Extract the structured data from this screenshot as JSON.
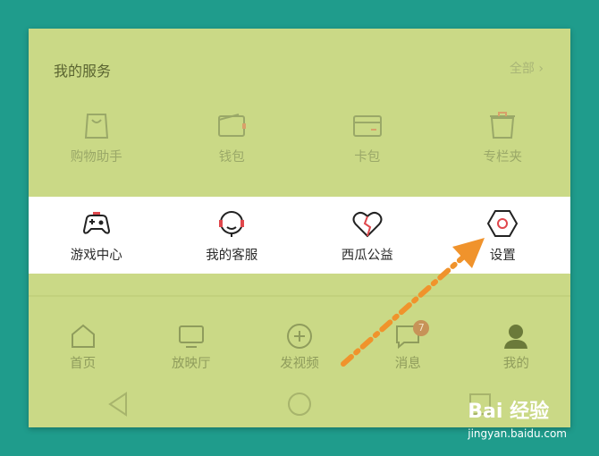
{
  "section": {
    "title": "我的服务",
    "see_all": "全部 ›"
  },
  "services_row1": [
    {
      "label": "购物助手",
      "icon": "shopping-bag-icon"
    },
    {
      "label": "钱包",
      "icon": "wallet-icon"
    },
    {
      "label": "卡包",
      "icon": "card-icon"
    },
    {
      "label": "专栏夹",
      "icon": "column-folder-icon"
    }
  ],
  "services_row2": [
    {
      "label": "游戏中心",
      "icon": "gamepad-icon"
    },
    {
      "label": "我的客服",
      "icon": "headset-icon"
    },
    {
      "label": "西瓜公益",
      "icon": "heart-icon"
    },
    {
      "label": "设置",
      "icon": "hex-settings-icon"
    }
  ],
  "bottom_nav": [
    {
      "label": "首页",
      "icon": "home-icon"
    },
    {
      "label": "放映厅",
      "icon": "tv-icon"
    },
    {
      "label": "发视频",
      "icon": "add-circle-icon"
    },
    {
      "label": "消息",
      "icon": "message-icon",
      "badge": "7"
    },
    {
      "label": "我的",
      "icon": "user-icon"
    }
  ],
  "system_nav": [
    "back-icon",
    "home-circle-icon",
    "recents-icon"
  ],
  "watermark": {
    "brand": "Bai  经验",
    "url": "jingyan.baidu.com"
  },
  "colors": {
    "panel": "#cad986",
    "frame": "#1f9c8c",
    "accent_red": "#e0474c",
    "arrow": "#f0932c"
  }
}
